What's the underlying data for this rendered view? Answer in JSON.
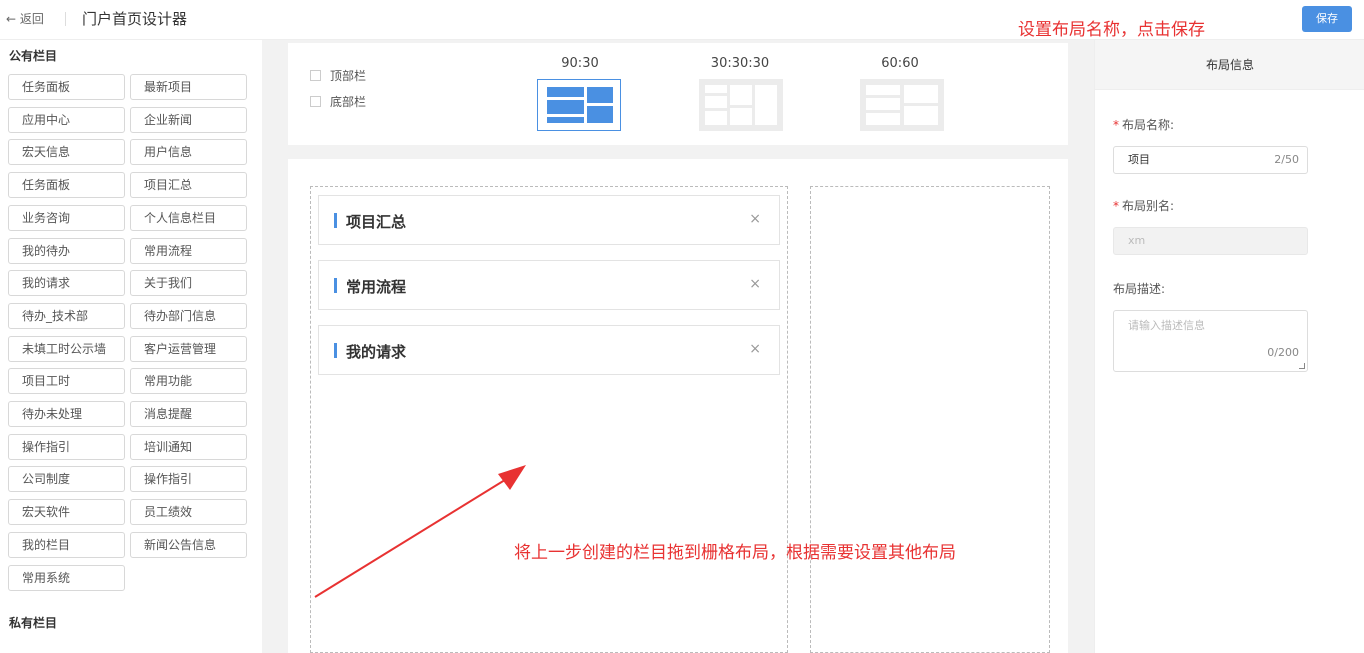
{
  "header": {
    "back_label": "← 返回",
    "title": "门户首页设计器",
    "save_label": "保存"
  },
  "annotations": {
    "top_right": "设置布局名称，点击保存",
    "center": "将上一步创建的栏目拖到栅格布局，根据需要设置其他布局"
  },
  "sidebar": {
    "public_title": "公有栏目",
    "private_title": "私有栏目",
    "items": [
      "任务面板",
      "最新项目",
      "应用中心",
      "企业新闻",
      "宏天信息",
      "用户信息",
      "任务面板",
      "项目汇总",
      "业务咨询",
      "个人信息栏目",
      "我的待办",
      "常用流程",
      "我的请求",
      "关于我们",
      "待办_技术部",
      "待办部门信息",
      "未填工时公示墙",
      "客户运营管理",
      "项目工时",
      "常用功能",
      "待办未处理",
      "消息提醒",
      "操作指引",
      "培训通知",
      "公司制度",
      "操作指引",
      "宏天软件",
      "员工绩效",
      "我的栏目",
      "新闻公告信息",
      "常用系统"
    ]
  },
  "layout": {
    "top_bar_label": "顶部栏",
    "bottom_bar_label": "底部栏",
    "options": [
      {
        "label": "90:30",
        "selected": true
      },
      {
        "label": "30:30:30",
        "selected": false
      },
      {
        "label": "60:60",
        "selected": false
      }
    ]
  },
  "grid": {
    "cards": [
      "项目汇总",
      "常用流程",
      "我的请求"
    ],
    "close_icon": "×"
  },
  "info_panel": {
    "title": "布局信息",
    "name_label": "布局名称:",
    "name_value": "项目",
    "name_count": "2/50",
    "alias_label": "布局别名:",
    "alias_value": "xm",
    "desc_label": "布局描述:",
    "desc_placeholder": "请输入描述信息",
    "desc_count": "0/200"
  },
  "colors": {
    "accent": "#4a90e2",
    "annotation": "#e83232"
  }
}
